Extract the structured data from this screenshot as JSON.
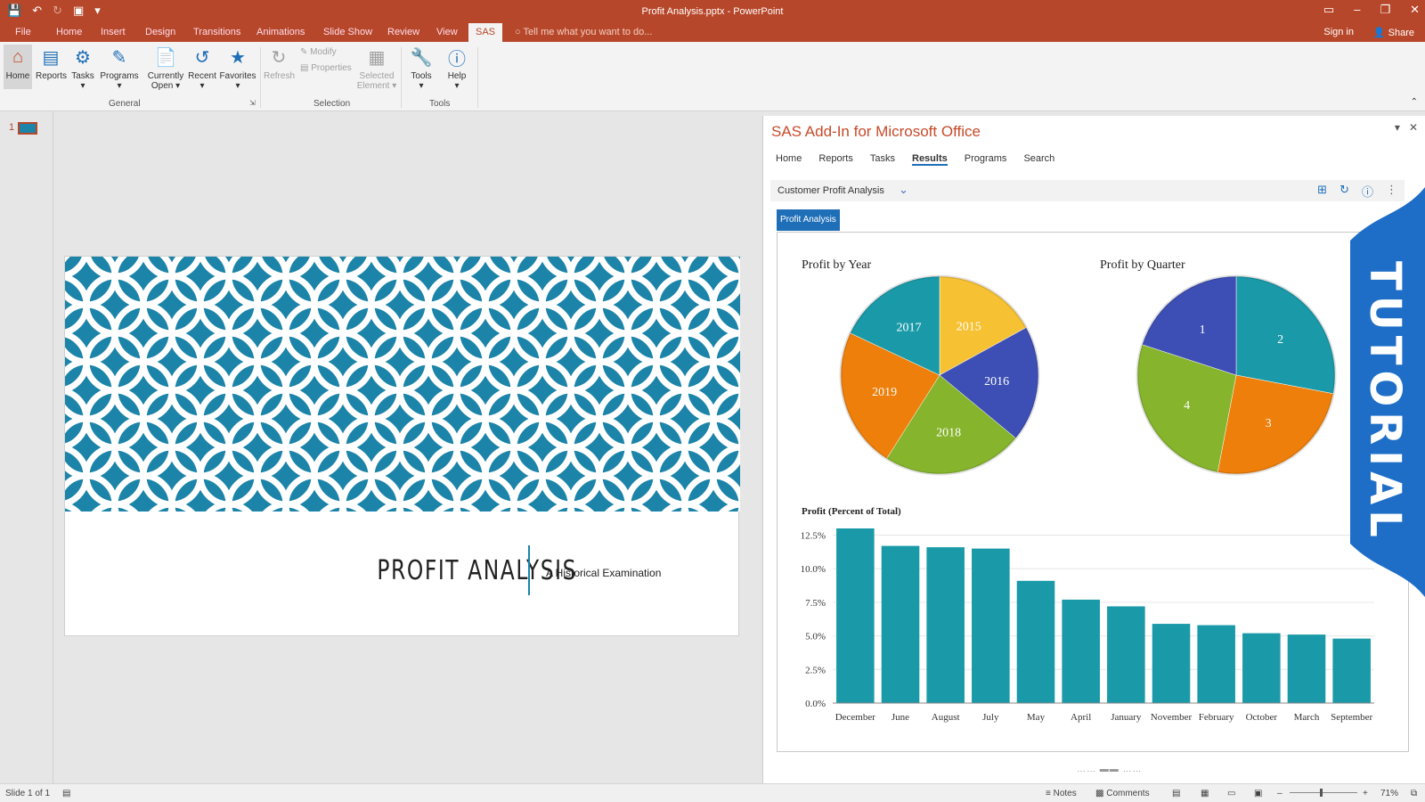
{
  "app": {
    "window_title": "Profit Analysis.pptx - PowerPoint",
    "menu_tabs": [
      "File",
      "Home",
      "Insert",
      "Design",
      "Transitions",
      "Animations",
      "Slide Show",
      "Review",
      "View",
      "SAS"
    ],
    "active_tab": "SAS",
    "tell_me": "Tell me what you want to do...",
    "sign_in": "Sign in",
    "share": "Share"
  },
  "ribbon": {
    "general": {
      "label": "General",
      "home": "Home",
      "reports": "Reports",
      "tasks": "Tasks",
      "programs": "Programs",
      "currently": "Currently",
      "open": "Open",
      "recent": "Recent",
      "favorites": "Favorites"
    },
    "selection": {
      "label": "Selection",
      "refresh": "Refresh",
      "modify": "Modify",
      "properties": "Properties",
      "selected": "Selected",
      "element": "Element"
    },
    "tools_group": {
      "label": "Tools",
      "tools": "Tools",
      "help": "Help"
    }
  },
  "thumbnails": {
    "slide_number": "1"
  },
  "slide": {
    "title": "PROFIT ANALYSIS",
    "subtitle": "A Historical Examination",
    "pattern_color": "#1b84a8"
  },
  "pane": {
    "title": "SAS Add-In for Microsoft Office",
    "nav": [
      "Home",
      "Reports",
      "Tasks",
      "Results",
      "Programs",
      "Search"
    ],
    "active_nav": "Results",
    "context": "Customer Profit Analysis",
    "result_tab": "Profit Analysis"
  },
  "overlay": {
    "tutorial": "TUTORIAL",
    "color": "#1e6ec8"
  },
  "chart_data": [
    {
      "type": "pie",
      "title": "Profit by Year",
      "labels": [
        "2015",
        "2016",
        "2018",
        "2019",
        "2017"
      ],
      "values": [
        17,
        19,
        23,
        23,
        18
      ],
      "colors": [
        "#f6c133",
        "#3d4fb5",
        "#86b42c",
        "#ee7f0a",
        "#1a9aa8"
      ]
    },
    {
      "type": "pie",
      "title": "Profit by Quarter",
      "labels": [
        "2",
        "3",
        "4",
        "1"
      ],
      "values": [
        28,
        25,
        27,
        20
      ],
      "colors": [
        "#1a9aa8",
        "#ee7f0a",
        "#86b42c",
        "#3d4fb5"
      ]
    },
    {
      "type": "bar",
      "title": "Profit (Percent of Total)",
      "categories": [
        "December",
        "June",
        "August",
        "July",
        "May",
        "April",
        "January",
        "November",
        "February",
        "October",
        "March",
        "September"
      ],
      "values": [
        13.0,
        11.7,
        11.6,
        11.5,
        9.1,
        7.7,
        7.2,
        5.9,
        5.8,
        5.2,
        5.1,
        4.8
      ],
      "yticks": [
        "0.0%",
        "2.5%",
        "5.0%",
        "7.5%",
        "10.0%",
        "12.5%"
      ],
      "ylim": [
        0,
        12.5
      ],
      "color": "#1a9aa8"
    }
  ],
  "status": {
    "slide": "Slide 1 of 1",
    "notes": "Notes",
    "comments": "Comments",
    "zoom": "71%"
  }
}
